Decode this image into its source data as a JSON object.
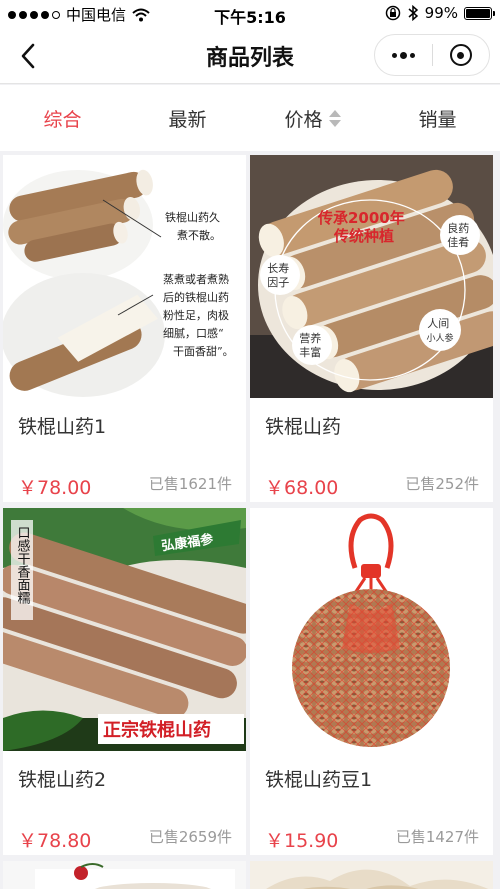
{
  "status_bar": {
    "carrier": "中国电信",
    "time": "下午5:16",
    "battery": "99%",
    "battery_level": 0.99,
    "icons": [
      "signal-dots-icon",
      "wifi-icon",
      "rotation-lock-icon",
      "bluetooth-icon",
      "battery-icon"
    ]
  },
  "nav": {
    "title": "商品列表",
    "icons": [
      "back-arrow-icon",
      "more-dots-icon",
      "close-target-icon"
    ]
  },
  "sort_tabs": [
    {
      "label": "综合",
      "active": true
    },
    {
      "label": "最新",
      "active": false
    },
    {
      "label": "价格",
      "active": false,
      "has_sort_icon": true
    },
    {
      "label": "销量",
      "active": false
    }
  ],
  "colors": {
    "accent": "#e8434b",
    "background": "#f1f1f4",
    "muted_text": "#9a9a9a"
  },
  "products": [
    {
      "name": "铁棍山药1",
      "price": "￥78.00",
      "sold": "已售1621件",
      "image_text": [
        "铁棍山药久",
        "煮不散。",
        "蒸煮或者煮熟",
        "后的铁棍山药",
        "粉性足，肉极",
        "细腻，口感“",
        "干面香甜”。"
      ]
    },
    {
      "name": "铁棍山药",
      "price": "￥68.00",
      "sold": "已售252件",
      "image_text": [
        "传承2000年",
        "传统种植",
        "良药",
        "佳肴",
        "长寿",
        "因子",
        "营养",
        "丰富",
        "人间",
        "小人参"
      ]
    },
    {
      "name": "铁棍山药2",
      "price": "￥78.80",
      "sold": "已售2659件",
      "image_text": [
        "弘康福参",
        "口感干香面糯",
        "正宗铁棍山药"
      ]
    },
    {
      "name": "铁棍山药豆1",
      "price": "￥15.90",
      "sold": "已售1427件",
      "image_text": []
    }
  ]
}
